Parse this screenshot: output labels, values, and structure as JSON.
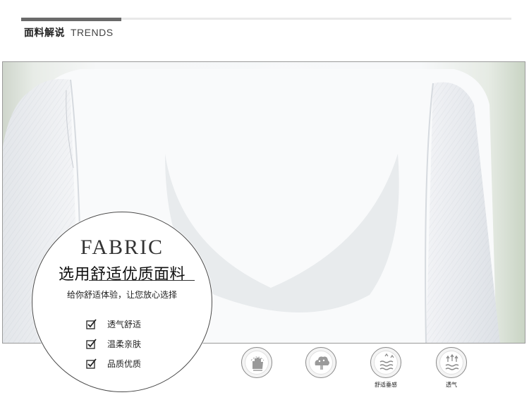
{
  "header": {
    "title_zh": "面料解说",
    "title_en": "TRENDS"
  },
  "badge": {
    "title": "FABRIC",
    "heading": "选用舒适优质面料",
    "subheading": "给你舒适体验，让您放心选择",
    "features": [
      {
        "label": "透气舒适",
        "icon": "checkbox-checked-icon"
      },
      {
        "label": "温柔亲肤",
        "icon": "checkbox-checked-icon"
      },
      {
        "label": "品质优质",
        "icon": "checkbox-checked-icon"
      }
    ]
  },
  "properties": [
    {
      "icon": "hand-fabric-icon",
      "label": ""
    },
    {
      "icon": "soft-cloud-icon",
      "label": ""
    },
    {
      "icon": "drape-waves-icon",
      "label": "舒适垂感"
    },
    {
      "icon": "breathable-icon",
      "label": "透气"
    }
  ]
}
